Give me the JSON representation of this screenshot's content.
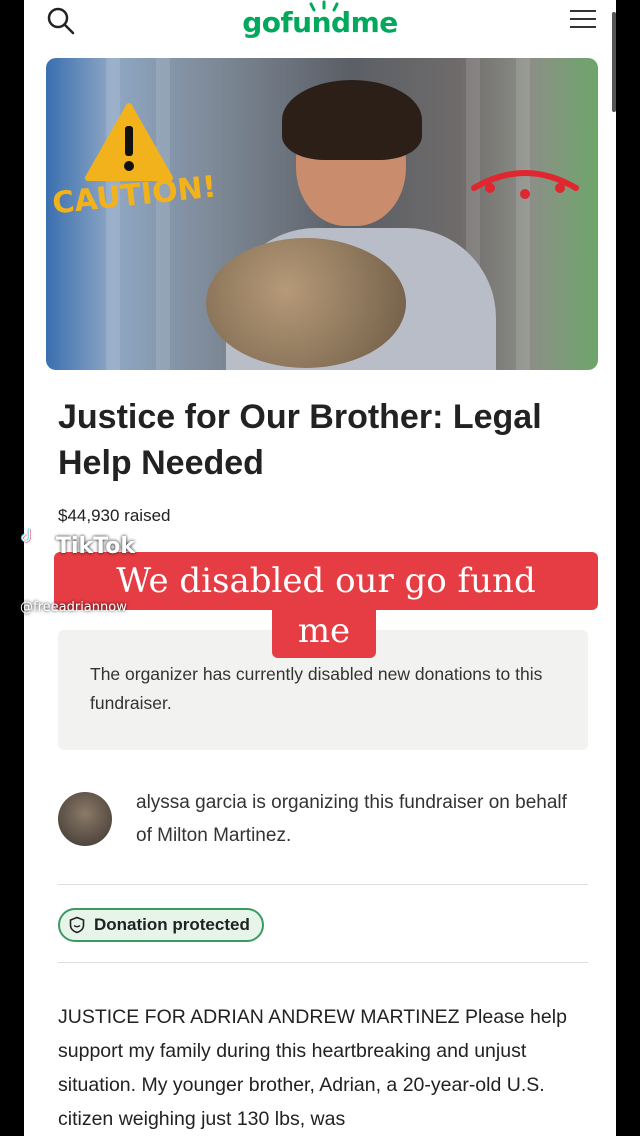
{
  "header": {
    "logo_text": "gofundme",
    "brand_color": "#02a95c",
    "search_icon": "search-icon",
    "menu_icon": "hamburger-menu-icon"
  },
  "hero": {
    "overlay_text": "CAUTION!",
    "caution_color": "#f2b21c"
  },
  "fundraiser": {
    "title": "Justice for Our Brother: Legal Help Needed",
    "raised": "$44,930 raised"
  },
  "overlay": {
    "tiktok_logo_text": "TikTok",
    "tiktok_username": "@freeadriannow",
    "caption_line1": "We disabled our go fund",
    "caption_line2": "me",
    "caption_color": "#e63c43"
  },
  "notice": {
    "text": "The organizer has currently disabled new donations to this fundraiser."
  },
  "organizer": {
    "text": "alyssa garcia is organizing this fundraiser on behalf of Milton Martinez."
  },
  "badge": {
    "label": "Donation protected",
    "icon": "shield-icon"
  },
  "story": {
    "text": "JUSTICE FOR ADRIAN ANDREW MARTINEZ Please help support my family during this heartbreaking and unjust situation. My younger brother, Adrian, a 20-year-old U.S. citizen weighing just 130 lbs, was"
  }
}
